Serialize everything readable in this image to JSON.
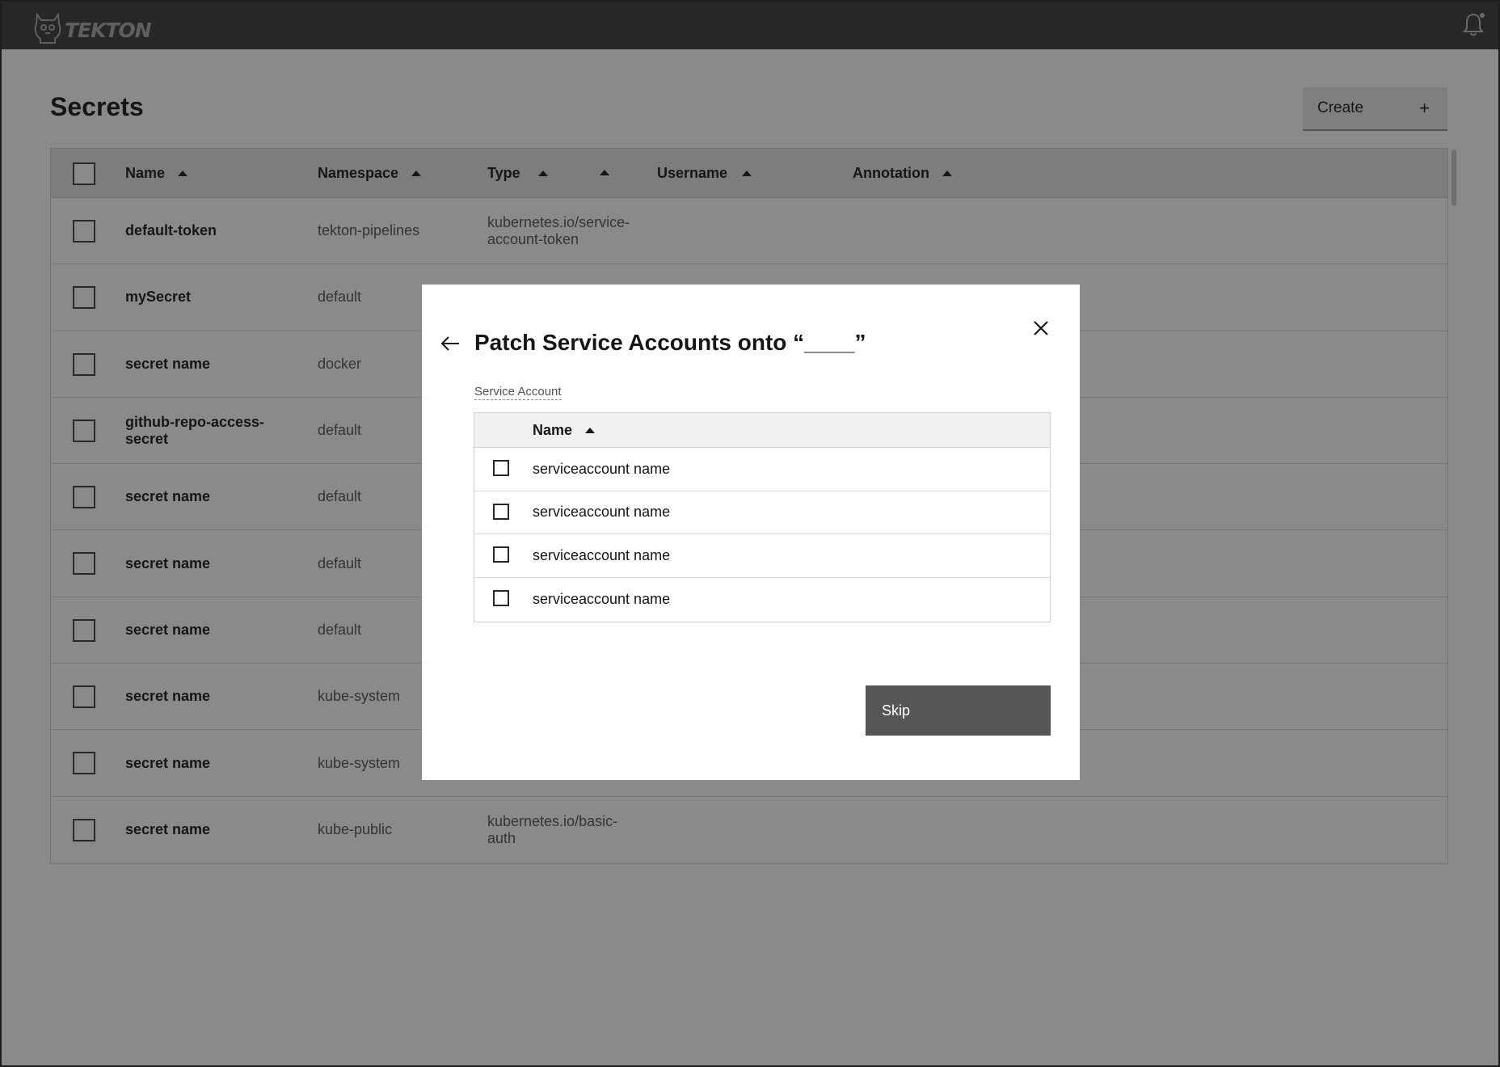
{
  "app": {
    "logo_text": "TEKTON"
  },
  "page": {
    "title": "Secrets",
    "create_label": "Create",
    "create_icon": "+"
  },
  "table": {
    "columns": [
      {
        "label": "Name"
      },
      {
        "label": "Namespace"
      },
      {
        "label": "Type"
      },
      {
        "label": "Username"
      },
      {
        "label": "Annotation"
      }
    ],
    "rows": [
      {
        "name": "default-token",
        "namespace": "tekton-pipelines",
        "type": "kubernetes.io/service-account-token"
      },
      {
        "name": "mySecret",
        "namespace": "default",
        "type": ""
      },
      {
        "name": "secret name",
        "namespace": "docker",
        "type": ""
      },
      {
        "name": "github-repo-access-secret",
        "namespace": "default",
        "type": ""
      },
      {
        "name": "secret name",
        "namespace": "default",
        "type": ""
      },
      {
        "name": "secret name",
        "namespace": "default",
        "type": ""
      },
      {
        "name": "secret name",
        "namespace": "default",
        "type": ""
      },
      {
        "name": "secret name",
        "namespace": "kube-system",
        "type": ""
      },
      {
        "name": "secret name",
        "namespace": "kube-system",
        "type": ""
      },
      {
        "name": "secret name",
        "namespace": "kube-public",
        "type": "kubernetes.io/basic-auth"
      }
    ]
  },
  "modal": {
    "title": "Patch Service Accounts onto “____”",
    "field_label": "Service Account",
    "column_label": "Name",
    "items": [
      {
        "label": "serviceaccount name"
      },
      {
        "label": "serviceaccount name"
      },
      {
        "label": "serviceaccount name"
      },
      {
        "label": "serviceaccount name"
      }
    ],
    "skip_label": "Skip"
  },
  "colors": {
    "topbar": "#383838",
    "skip_button": "#555555",
    "overlay": "rgba(22,22,22,0.5)"
  }
}
